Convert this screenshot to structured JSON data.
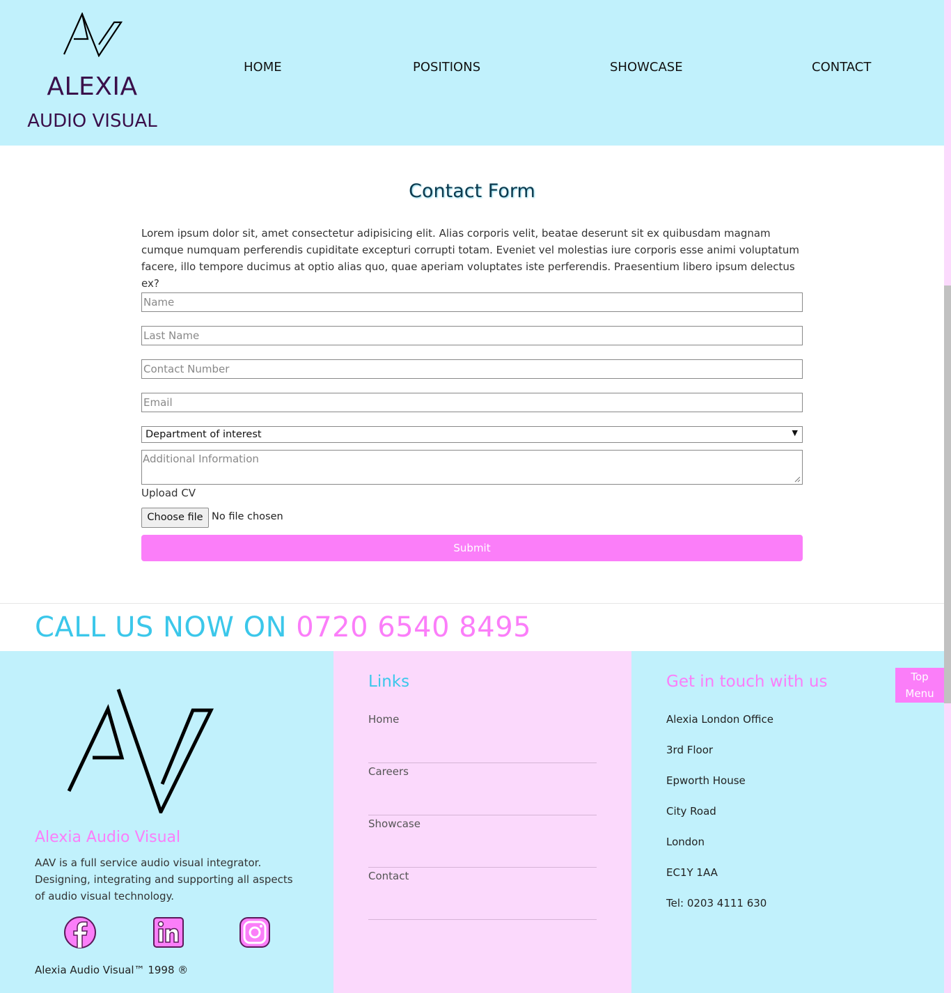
{
  "header": {
    "logo_name": "ALEXIA",
    "logo_sub": "AUDIO VISUAL",
    "logo_icon": "av-logo-icon",
    "nav": [
      "HOME",
      "POSITIONS",
      "SHOWCASE",
      "CONTACT"
    ]
  },
  "main": {
    "title": "Contact Form",
    "intro": "Lorem ipsum dolor sit, amet consectetur adipisicing elit. Alias corporis velit, beatae deserunt sit ex quibusdam magnam cumque numquam perferendis cupiditate excepturi corrupti totam. Eveniet vel molestias iure corporis esse animi voluptatum facere, illo tempore ducimus at optio alias quo, quae aperiam voluptates iste perferendis. Praesentium libero ipsum delectus ex?",
    "form": {
      "name_placeholder": "Name",
      "last_name_placeholder": "Last Name",
      "contact_number_placeholder": "Contact Number",
      "email_placeholder": "Email",
      "department_selected": "Department of interest",
      "additional_placeholder": "Additional Information",
      "upload_label": "Upload CV",
      "choose_file": "Choose file",
      "file_status": "No file chosen",
      "submit": "Submit"
    }
  },
  "call": {
    "prefix": "CALL US NOW ON",
    "number": "0720 6540 8495"
  },
  "footer": {
    "brand": "Alexia Audio Visual",
    "description": "AAV is a full service audio visual integrator. Designing, integrating and supporting all aspects of audio visual technology.",
    "social_icons": [
      "facebook-icon",
      "linkedin-icon",
      "instagram-icon"
    ],
    "copyright": "Alexia Audio Visual™ 1998 ®",
    "links_title": "Links",
    "links": [
      "Home",
      "Careers",
      "Showcase",
      "Contact"
    ],
    "contact_title": "Get in touch with us",
    "address": [
      "Alexia London Office",
      "3rd Floor",
      "Epworth House",
      "City Road",
      "London",
      "EC1Y 1AA",
      "Tel: 0203 4111 630"
    ],
    "top_menu": [
      "Top",
      "Menu"
    ]
  },
  "colors": {
    "header_bg": "#c1f1fc",
    "accent_pink": "#fb7ef9",
    "accent_cyan": "#3bc7ea",
    "links_bg": "#fbd9fc",
    "logo_text": "#3a0f4a"
  }
}
